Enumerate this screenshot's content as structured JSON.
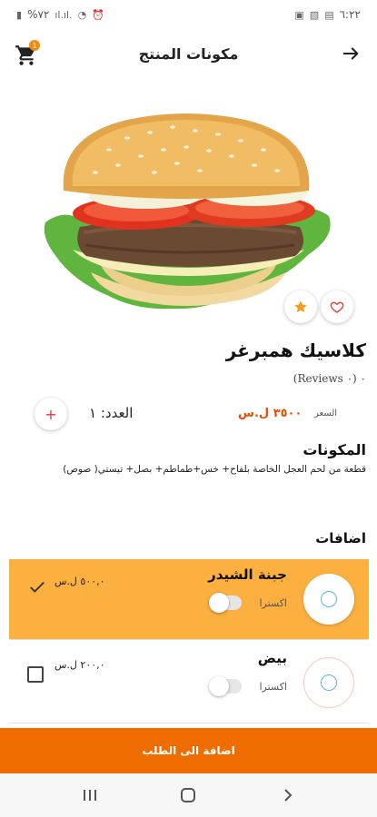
{
  "status_bar": {
    "time": "٦:٢٢",
    "battery": "%٧٢"
  },
  "header": {
    "title": "مكونات المنتج",
    "cart_count": "1"
  },
  "product": {
    "name": "كلاسيك همبرغر",
    "reviews": "٠ (٠ Reviews)",
    "price_label": "السعر",
    "price_value": "٣٥٠٠ ل.س",
    "quantity_label": "العدد: ١",
    "plus_label": "+"
  },
  "ingredients": {
    "title": "المكونات",
    "text": "قطعة من لحم العجل الخاصة بلفاح+ خس+طماطم+ بصل+ تيستي( صوص)"
  },
  "additions": {
    "title": "اضافات",
    "items": [
      {
        "name": "جبنة الشيدر",
        "price": "٥٠٠,٠ ل.س",
        "extra_label": "اكسترا",
        "selected": true
      },
      {
        "name": "بيض",
        "price": "٢٠٠,٠ ل.س",
        "extra_label": "اكسترا",
        "selected": false
      }
    ]
  },
  "add_to_order": {
    "label": "اضافة الى الطلب"
  },
  "colors": {
    "accent": "#ef6c00",
    "selected_row": "#fbb040",
    "price": "#e65100"
  },
  "icons": [
    "back-arrow-icon",
    "cart-icon",
    "star-icon",
    "heart-icon",
    "plus-icon",
    "check-icon",
    "checkbox-icon",
    "recents-icon",
    "home-icon",
    "nav-back-icon"
  ]
}
